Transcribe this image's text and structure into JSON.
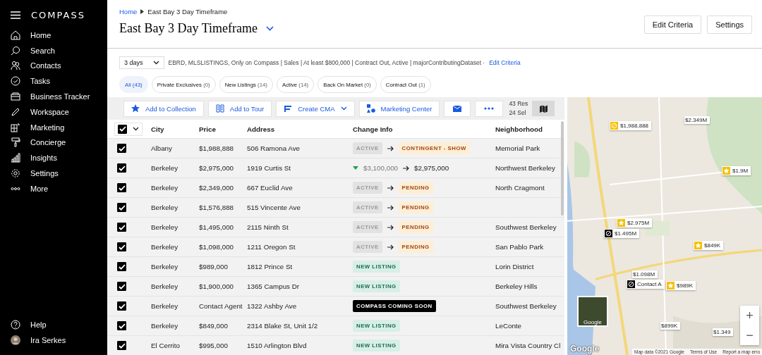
{
  "sidebar": {
    "logo": "COMPASS",
    "items": [
      {
        "label": "Home"
      },
      {
        "label": "Search"
      },
      {
        "label": "Contacts"
      },
      {
        "label": "Tasks"
      },
      {
        "label": "Business Tracker"
      },
      {
        "label": "Workspace"
      },
      {
        "label": "Marketing"
      },
      {
        "label": "Concierge"
      },
      {
        "label": "Insights"
      },
      {
        "label": "Settings"
      },
      {
        "label": "More"
      }
    ],
    "footer": [
      {
        "label": "Help"
      },
      {
        "label": "Ira Serkes"
      }
    ]
  },
  "breadcrumb": [
    {
      "label": "Home",
      "link": true
    },
    {
      "label": "East Bay 3 Day Timeframe",
      "link": false
    }
  ],
  "title": "East Bay 3 Day Timeframe",
  "header_buttons": [
    "Edit Criteria",
    "Settings"
  ],
  "criteria": {
    "timeframe": "3 days",
    "summary": "EBRD, MLSLISTINGS, Only on Compass | Sales | At least $800,000 | Contract Out, Active | majorContributingDataset ·",
    "link": "Edit Criteria"
  },
  "filters": [
    {
      "label": "All",
      "count": "(43)",
      "selected": true
    },
    {
      "label": "Private Exclusives",
      "count": "(0)",
      "selected": false
    },
    {
      "label": "New Listings",
      "count": "(14)",
      "selected": false
    },
    {
      "label": "Active",
      "count": "(14)",
      "selected": false
    },
    {
      "label": "Back On Market",
      "count": "(0)",
      "selected": false
    },
    {
      "label": "Contract Out",
      "count": "(1)",
      "selected": false
    }
  ],
  "toolbar": {
    "buttons": [
      {
        "label": "Add to Collection",
        "dropdown": false
      },
      {
        "label": "Add to Tour",
        "dropdown": false
      },
      {
        "label": "Create CMA",
        "dropdown": true
      },
      {
        "label": "Marketing Center",
        "dropdown": false
      }
    ],
    "results": "43 Res",
    "selected": "24 Sel"
  },
  "table": {
    "select_all": {
      "checked": true
    },
    "columns": [
      "City",
      "Price",
      "Address",
      "Change Info",
      "Neighborhood"
    ],
    "rows": [
      {
        "checked": true,
        "city": "Albany",
        "price": "$1,988,888",
        "address": "506 Ramona Ave",
        "change": {
          "kind": "status",
          "from": "ACTIVE",
          "to": "CONTINGENT - SHOW"
        },
        "neighborhood": "Memorial Park"
      },
      {
        "checked": true,
        "city": "Berkeley",
        "price": "$2,975,000",
        "address": "1919 Curtis St",
        "change": {
          "kind": "price_drop",
          "from": "$3,100,000",
          "to": "$2,975,000"
        },
        "neighborhood": "Northwest Berkeley"
      },
      {
        "checked": true,
        "city": "Berkeley",
        "price": "$2,349,000",
        "address": "667 Euclid Ave",
        "change": {
          "kind": "status",
          "from": "ACTIVE",
          "to": "PENDING"
        },
        "neighborhood": "North Cragmont"
      },
      {
        "checked": true,
        "city": "Berkeley",
        "price": "$1,576,888",
        "address": "515 Vincente Ave",
        "change": {
          "kind": "status",
          "from": "ACTIVE",
          "to": "PENDING"
        }
      },
      {
        "checked": true,
        "city": "Berkeley",
        "price": "$1,495,000",
        "address": "2115 Ninth St",
        "change": {
          "kind": "status",
          "from": "ACTIVE",
          "to": "PENDING"
        },
        "neighborhood": "Southwest Berkeley"
      },
      {
        "checked": true,
        "city": "Berkeley",
        "price": "$1,098,000",
        "address": "1211 Oregon St",
        "change": {
          "kind": "status",
          "from": "ACTIVE",
          "to": "PENDING"
        },
        "neighborhood": "San Pablo Park"
      },
      {
        "checked": true,
        "city": "Berkeley",
        "price": "$989,000",
        "address": "1812 Prince St",
        "change": {
          "kind": "new",
          "label": "NEW LISTING"
        },
        "neighborhood": "Lorin District"
      },
      {
        "checked": true,
        "city": "Berkeley",
        "price": "$1,900,000",
        "address": "1365 Campus Dr",
        "change": {
          "kind": "new",
          "label": "NEW LISTING"
        },
        "neighborhood": "Berkeley Hills"
      },
      {
        "checked": true,
        "city": "Berkeley",
        "price": "Contact Agent",
        "address": "1322 Ashby Ave",
        "change": {
          "kind": "coming_soon",
          "label": "COMPASS COMING SOON"
        },
        "neighborhood": "Southwest Berkeley"
      },
      {
        "checked": true,
        "city": "Berkeley",
        "price": "$849,000",
        "address": "2314 Blake St, Unit 1/2",
        "change": {
          "kind": "new",
          "label": "NEW LISTING"
        },
        "neighborhood": "LeConte"
      },
      {
        "checked": true,
        "city": "El Cerrito",
        "price": "$995,000",
        "address": "1510 Arlington Blvd",
        "change": {
          "kind": "new",
          "label": "NEW LISTING"
        },
        "neighborhood": "Mira Vista Country Cl"
      }
    ]
  },
  "map": {
    "kind": "picture",
    "markers": [
      {
        "price": "$1,988,888",
        "kind": "exclusive"
      },
      {
        "price": "$2.349M",
        "kind": "plain"
      },
      {
        "price": "$1.9M",
        "kind": "star"
      },
      {
        "price": "$2.975M",
        "kind": "star"
      },
      {
        "price": "$1.495M",
        "kind": "coming"
      },
      {
        "price": "$849K",
        "kind": "star"
      },
      {
        "price": "$1.098M",
        "kind": "plain"
      },
      {
        "price": "Contact A",
        "kind": "coming"
      },
      {
        "price": "$989K",
        "kind": "star"
      },
      {
        "price": "$899K",
        "kind": "plain"
      },
      {
        "price": "$1.349",
        "kind": "plain"
      }
    ],
    "zoom_in": "+",
    "zoom_out": "−",
    "thumbnail_label": "Google",
    "logo": "Google",
    "attribution": [
      "Map data ©2021 Google",
      "Terms of Use",
      "Report a map erro"
    ]
  }
}
